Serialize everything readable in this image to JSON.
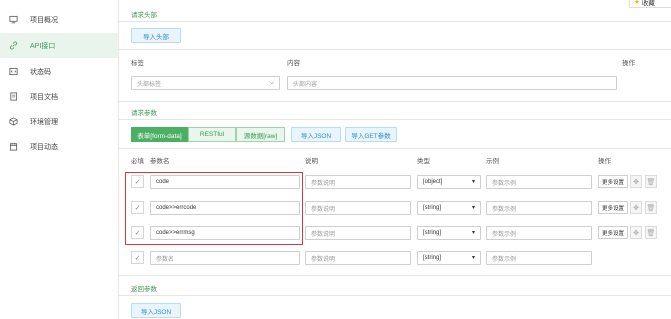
{
  "sidebar": {
    "items": [
      {
        "label": "项目概况",
        "icon": "monitor-icon"
      },
      {
        "label": "API接口",
        "icon": "link-icon",
        "active": true
      },
      {
        "label": "状态码",
        "icon": "code-icon"
      },
      {
        "label": "项目文档",
        "icon": "document-icon"
      },
      {
        "label": "环境管理",
        "icon": "cube-icon"
      },
      {
        "label": "项目动态",
        "icon": "calendar-icon"
      }
    ]
  },
  "top_right_button": "收藏",
  "headers_section": {
    "title": "请求头部",
    "import_button": "导入头部",
    "columns": {
      "label": "标签",
      "content": "内容",
      "action": "操作"
    },
    "row": {
      "label_placeholder": "头部标签",
      "content_placeholder": "头部内容"
    }
  },
  "params_section": {
    "title": "请求参数",
    "tabs": [
      "表单[form-data]",
      "RESTful",
      "源数据[raw]"
    ],
    "import_json": "导入JSON",
    "import_get": "导入GET参数",
    "columns": {
      "required": "必填",
      "name": "参数名",
      "desc": "说明",
      "type": "类型",
      "example": "示例",
      "action": "操作"
    },
    "rows": [
      {
        "name": "code",
        "desc_placeholder": "参数说明",
        "type": "[object]",
        "example_placeholder": "参数示例",
        "more": "更多设置"
      },
      {
        "name": "code>>errcode",
        "desc_placeholder": "参数说明",
        "type": "[string]",
        "example_placeholder": "参数示例",
        "more": "更多设置"
      },
      {
        "name": "code>>errmsg",
        "desc_placeholder": "参数说明",
        "type": "[string]",
        "example_placeholder": "参数示例",
        "more": "更多设置"
      },
      {
        "name_placeholder": "参数名",
        "desc_placeholder": "参数说明",
        "type": "[string]",
        "example_placeholder": "参数示例"
      }
    ]
  },
  "response_section": {
    "title": "返回参数",
    "import_json": "导入JSON"
  },
  "colors": {
    "accent_green": "#3c9a55",
    "accent_blue": "#2d8bd3",
    "highlight_red": "#d9383a"
  }
}
